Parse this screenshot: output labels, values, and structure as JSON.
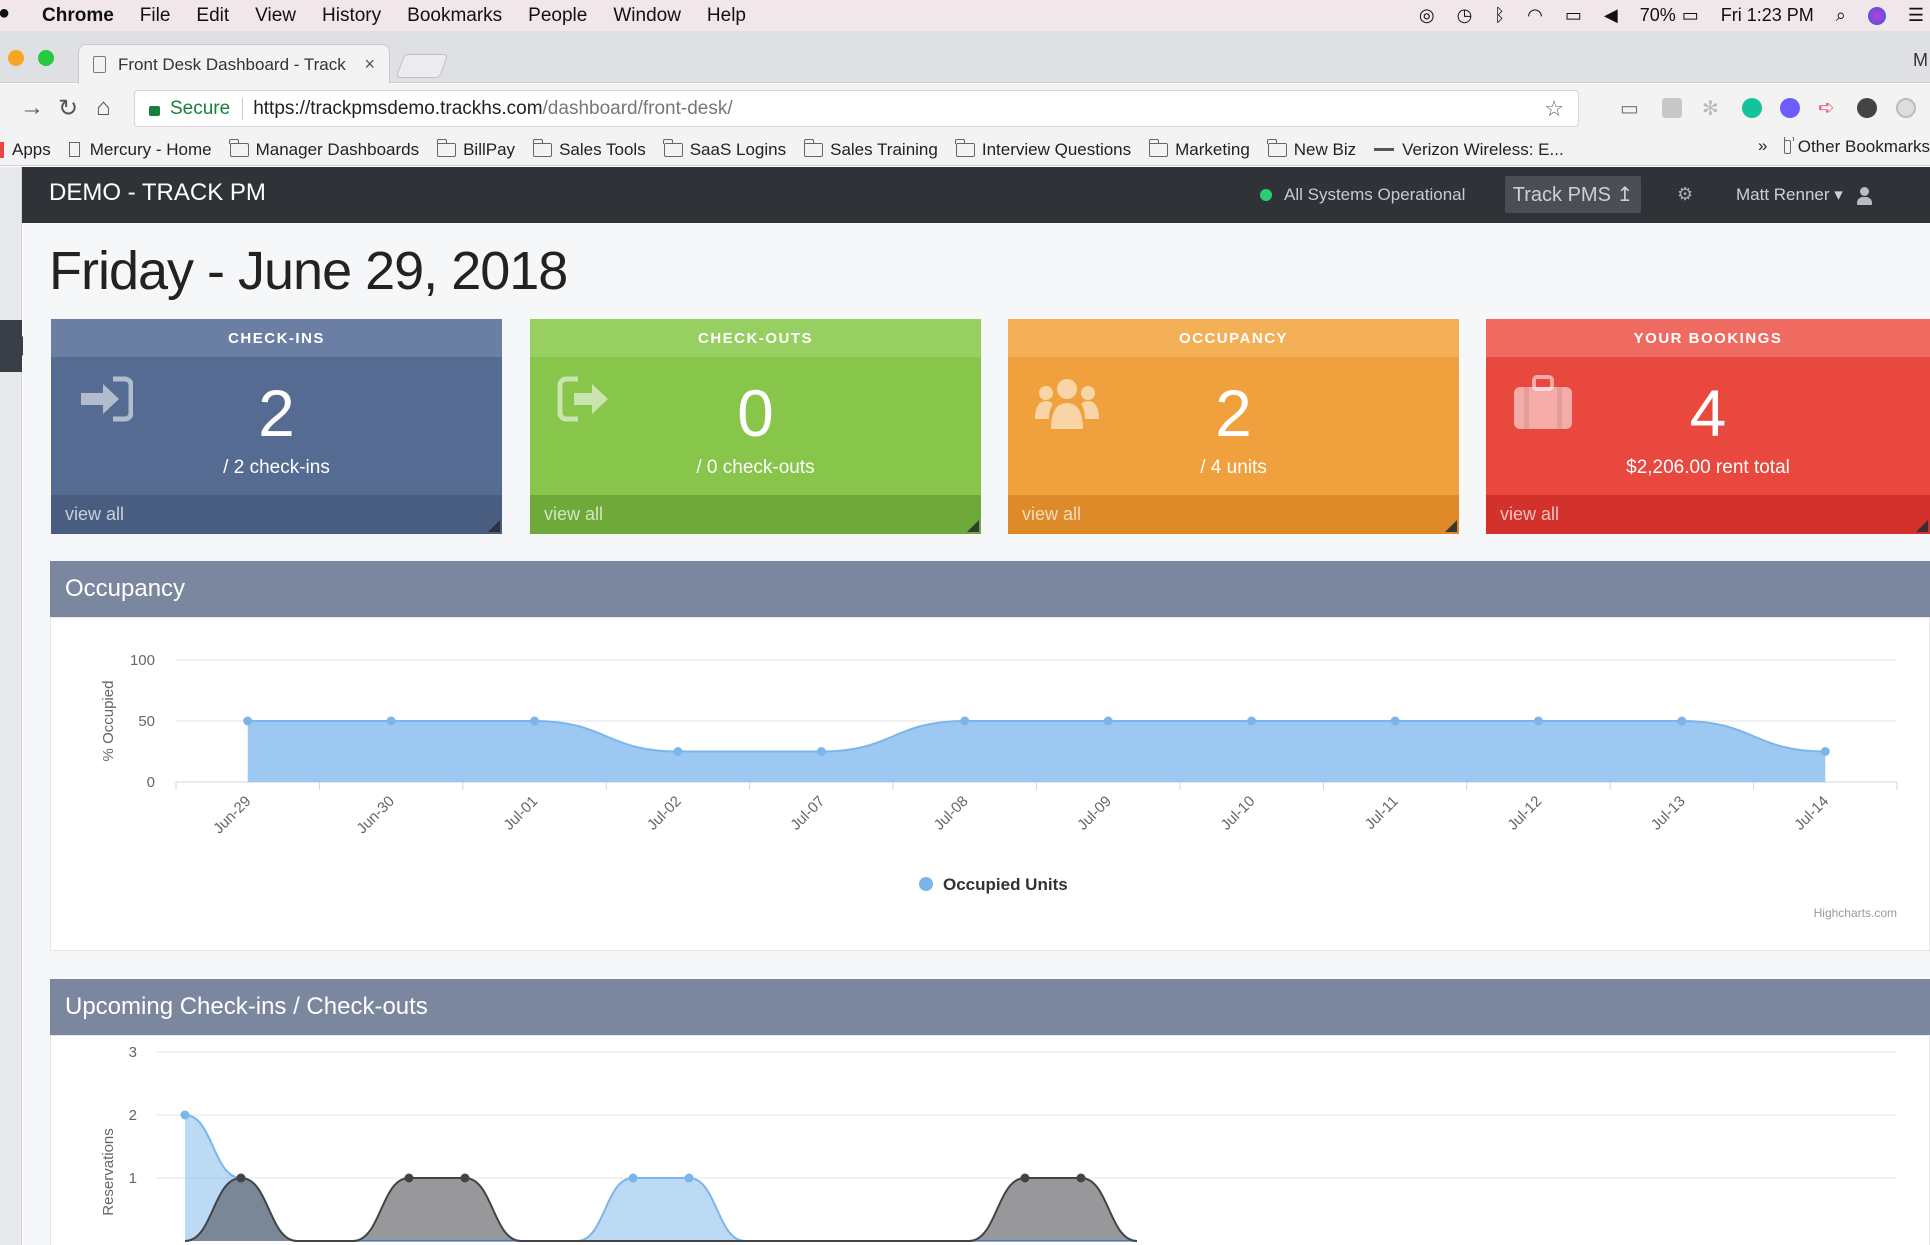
{
  "menubar": {
    "items": [
      "Chrome",
      "File",
      "Edit",
      "View",
      "History",
      "Bookmarks",
      "People",
      "Window",
      "Help"
    ],
    "battery": "70%",
    "clock": "Fri 1:23 PM"
  },
  "browser": {
    "tab_title": "Front Desk Dashboard - Track",
    "profile_initial": "M",
    "secure_label": "Secure",
    "url_host": "https://trackpmsdemo.trackhs.com",
    "url_path": "/dashboard/front-desk/",
    "bookmarks": [
      "Apps",
      "Mercury - Home",
      "Manager Dashboards",
      "BillPay",
      "Sales Tools",
      "SaaS Logins",
      "Sales Training",
      "Interview Questions",
      "Marketing",
      "New Biz",
      "Verizon Wireless: E...",
      "Other Bookmarks"
    ],
    "bookmarks_overflow": "»"
  },
  "app": {
    "brand": "DEMO - TRACK PM",
    "system_status": "All Systems Operational",
    "track_button": "Track PMS ↥",
    "user_name": "Matt Renner ▾",
    "date_heading": "Friday - June 29, 2018"
  },
  "cards": [
    {
      "title": "CHECK-INS",
      "value": "2",
      "sub": "/ 2 check-ins",
      "link": "view all",
      "icon": "sign-in-icon",
      "color_head": "#6a7fa3",
      "color_body": "#566b91",
      "color_foot": "#485d80"
    },
    {
      "title": "CHECK-OUTS",
      "value": "0",
      "sub": "/ 0 check-outs",
      "link": "view all",
      "icon": "sign-out-icon",
      "color_head": "#98cf63",
      "color_body": "#87c54b",
      "color_foot": "#6ea93a"
    },
    {
      "title": "OCCUPANCY",
      "value": "2",
      "sub": "/ 4 units",
      "link": "view all",
      "icon": "users-icon",
      "color_head": "#f3b057",
      "color_body": "#f0a03c",
      "color_foot": "#de8a28"
    },
    {
      "title": "YOUR BOOKINGS",
      "value": "4",
      "sub": "$2,206.00 rent total",
      "link": "view all",
      "icon": "briefcase-icon",
      "color_head": "#ef6b61",
      "color_body": "#e9483e",
      "color_foot": "#d2322b"
    }
  ],
  "panels": {
    "occupancy_title": "Occupancy",
    "upcoming_title": "Upcoming Check-ins / Check-outs",
    "credit": "Highcharts.com"
  },
  "chart_data": [
    {
      "type": "area",
      "title": "",
      "ylabel": "% Occupied",
      "xlabel": "",
      "ylim": [
        0,
        100
      ],
      "yticks": [
        0,
        50,
        100
      ],
      "categories": [
        "Jun-29",
        "Jun-30",
        "Jul-01",
        "Jul-02",
        "Jul-07",
        "Jul-08",
        "Jul-09",
        "Jul-10",
        "Jul-11",
        "Jul-12",
        "Jul-13",
        "Jul-14"
      ],
      "series": [
        {
          "name": "Occupied Units",
          "color": "#7cb5ec",
          "values": [
            50,
            50,
            50,
            25,
            25,
            50,
            50,
            50,
            50,
            50,
            50,
            25
          ]
        }
      ],
      "legend": "bottom-center",
      "grid": true
    },
    {
      "type": "area",
      "title": "",
      "ylabel": "Reservations",
      "ylim": [
        0,
        3
      ],
      "yticks": [
        1,
        2,
        3
      ],
      "categories": [],
      "series": [
        {
          "color": "#7cb5ec",
          "values": [
            2,
            1,
            0,
            0,
            0,
            0,
            0,
            0,
            1,
            1,
            0,
            0,
            0,
            0,
            0,
            0,
            0,
            0
          ]
        },
        {
          "color": "#434348",
          "values": [
            0,
            1,
            0,
            0,
            1,
            1,
            0,
            0,
            0,
            0,
            0,
            0,
            0,
            0,
            0,
            1,
            1,
            0
          ]
        }
      ],
      "grid": true
    }
  ]
}
